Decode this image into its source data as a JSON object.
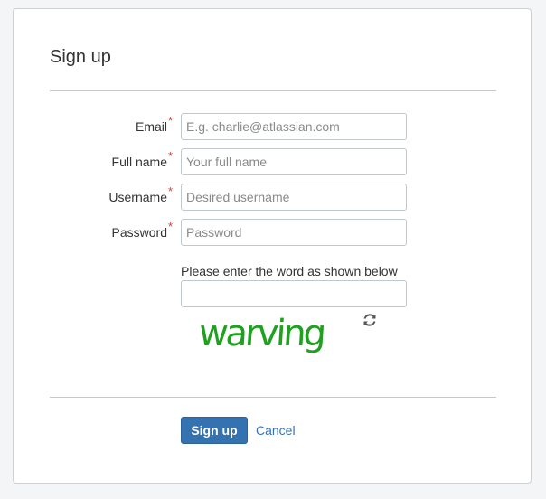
{
  "form": {
    "title": "Sign up",
    "required_marker": "*",
    "fields": [
      {
        "label": "Email",
        "placeholder": "E.g. charlie@atlassian.com",
        "value": ""
      },
      {
        "label": "Full name",
        "placeholder": "Your full name",
        "value": ""
      },
      {
        "label": "Username",
        "placeholder": "Desired username",
        "value": ""
      },
      {
        "label": "Password",
        "placeholder": "Password",
        "value": ""
      }
    ],
    "captcha": {
      "prompt": "Please enter the word as shown below",
      "word": "warving",
      "value": "",
      "color": "#1ea11e",
      "refresh_icon": "refresh-icon"
    },
    "actions": {
      "submit_label": "Sign up",
      "cancel_label": "Cancel"
    }
  },
  "colors": {
    "primary": "#3572b0",
    "required": "#d04437"
  }
}
